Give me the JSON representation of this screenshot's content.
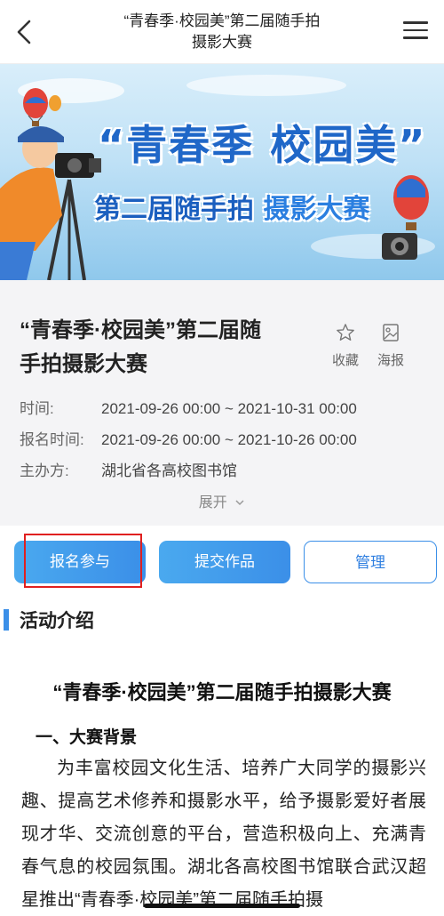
{
  "header": {
    "title_line1": "“青春季·校园美”第二届随手拍",
    "title_line2": "摄影大赛"
  },
  "banner": {
    "line1": "“青春季 校园美”",
    "line2_part1": "第二届随手拍",
    "line2_part2": "摄影大赛"
  },
  "event": {
    "title_line1": "“青春季·校园美”第二届随",
    "title_line2": "手拍摄影大赛",
    "favorite_label": "收藏",
    "poster_label": "海报",
    "time_label": "时间:",
    "time_value": "2021-09-26 00:00 ~ 2021-10-31 00:00",
    "signup_time_label": "报名时间:",
    "signup_time_value": "2021-09-26 00:00 ~ 2021-10-26 00:00",
    "organizer_label": "主办方:",
    "organizer_value": "湖北省各高校图书馆",
    "expand_label": "展开"
  },
  "actions": {
    "signup_label": "报名参与",
    "submit_label": "提交作品",
    "manage_label": "管理"
  },
  "intro": {
    "section_title": "活动介绍",
    "article_title": "“青春季·校园美”第二届随手拍摄影大赛",
    "subheading": "一、大赛背景",
    "paragraph": "为丰富校园文化生活、培养广大同学的摄影兴趣、提高艺术修养和摄影水平，给予摄影爱好者展现才华、交流创意的平台，营造积极向上、充满青春气息的校园氛围。湖北各高校图书馆联合武汉超星推出“青春季·校园美”第二届随手拍摄"
  },
  "colors": {
    "accent": "#3b8fe8",
    "highlight_box": "#e02020"
  }
}
